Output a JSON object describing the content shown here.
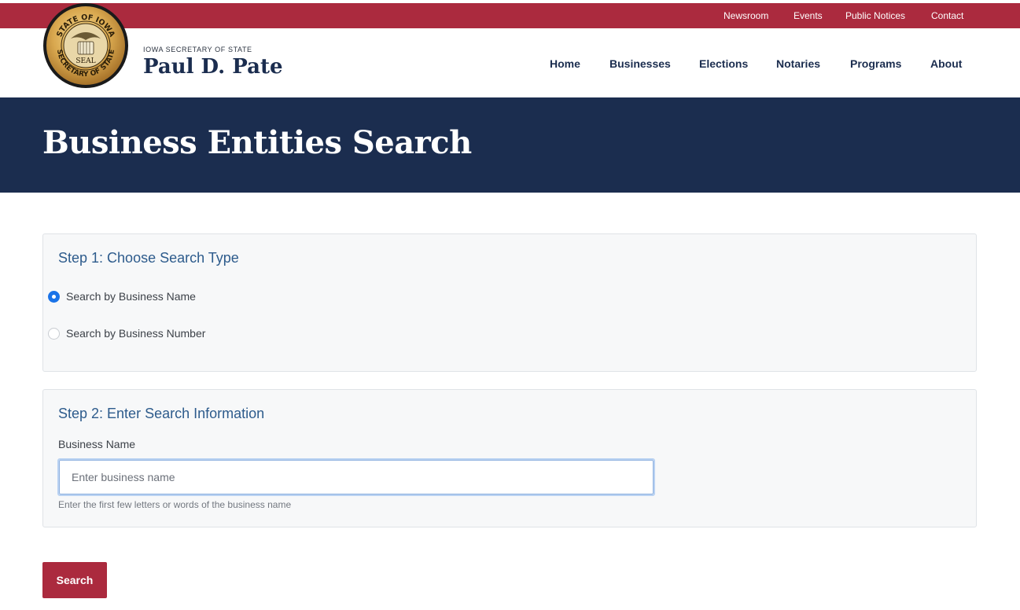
{
  "utility_nav": [
    "Newsroom",
    "Events",
    "Public Notices",
    "Contact"
  ],
  "seal": {
    "top_text": "STATE OF IOWA",
    "bottom_text": "SECRETARY OF STATE",
    "center_text": "SEAL"
  },
  "header": {
    "agency": "IOWA SECRETARY OF STATE",
    "official_name": "Paul D. Pate"
  },
  "main_nav": [
    "Home",
    "Businesses",
    "Elections",
    "Notaries",
    "Programs",
    "About"
  ],
  "banner": {
    "title": "Business Entities Search"
  },
  "step1": {
    "title": "Step 1: Choose Search Type",
    "options": [
      {
        "label": "Search by Business Name",
        "selected": true
      },
      {
        "label": "Search by Business Number",
        "selected": false
      }
    ]
  },
  "step2": {
    "title": "Step 2: Enter Search Information",
    "field_label": "Business Name",
    "input_value": "",
    "placeholder": "Enter business name",
    "help_text": "Enter the first few letters or words of the business name"
  },
  "search_button": "Search",
  "colors": {
    "brand_red": "#ab2a3e",
    "navy": "#1b2d4f",
    "step_title_blue": "#2d5b8c",
    "radio_selected": "#1a73e8"
  }
}
